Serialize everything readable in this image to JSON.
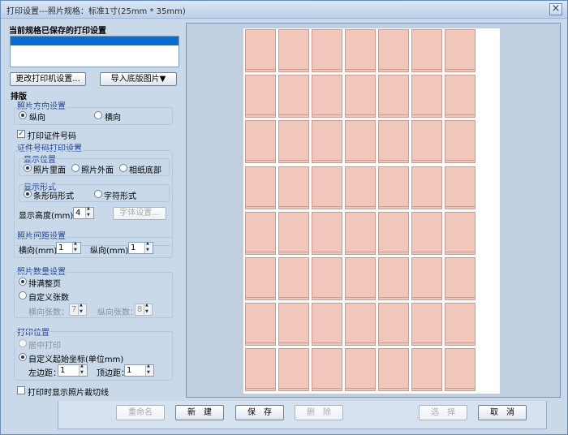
{
  "window": {
    "title": "打印设置---照片规格：标准1寸(25mm * 35mm)",
    "close_label": "×"
  },
  "saved_settings": {
    "label": "当前规格已保存的打印设置"
  },
  "buttons": {
    "change_printer": "更改打印机设置...",
    "import_background": "导入底版图片▼",
    "font_settings": "字体设置...",
    "rename": "重命名",
    "new": "新　建",
    "save": "保　存",
    "delete": "删　除",
    "select": "选　择",
    "cancel": "取　消"
  },
  "layout_section": {
    "title": "排版"
  },
  "orientation": {
    "title": "照片方向设置",
    "portrait": "纵向",
    "landscape": "横向",
    "selected": "portrait"
  },
  "print_id": {
    "label": "打印证件号码",
    "checked": true
  },
  "id_print": {
    "title": "证件号码打印设置",
    "position_title": "显示位置",
    "pos_inside": "照片里面",
    "pos_outside": "照片外面",
    "pos_bottom": "相纸底部",
    "form_title": "显示形式",
    "form_barcode": "条形码形式",
    "form_text": "字符形式",
    "height_label": "显示高度(mm)：",
    "height_value": "4"
  },
  "spacing": {
    "title": "照片间距设置",
    "h_label": "横向(mm)：",
    "h_value": "1",
    "v_label": "纵向(mm)：",
    "v_value": "1"
  },
  "quantity": {
    "title": "照片数量设置",
    "fill_page": "排满整页",
    "custom": "自定义张数",
    "h_count_label": "横向张数：",
    "h_count": "7",
    "v_count_label": "纵向张数：",
    "v_count": "8"
  },
  "print_position": {
    "title": "打印位置",
    "center": "居中打印",
    "custom_origin": "自定义起始坐标(单位mm)",
    "left_label": "左边距：",
    "left_value": "1",
    "top_label": "顶边距：",
    "top_value": "1"
  },
  "show_cut_lines": {
    "label": "打印时显示照片裁切线",
    "checked": false
  },
  "preview": {
    "columns": 7,
    "rows": 8
  },
  "colors": {
    "photo_cell": "#f1c6bb",
    "selection": "#0a6bd1",
    "group_title": "#1a3f8e"
  }
}
